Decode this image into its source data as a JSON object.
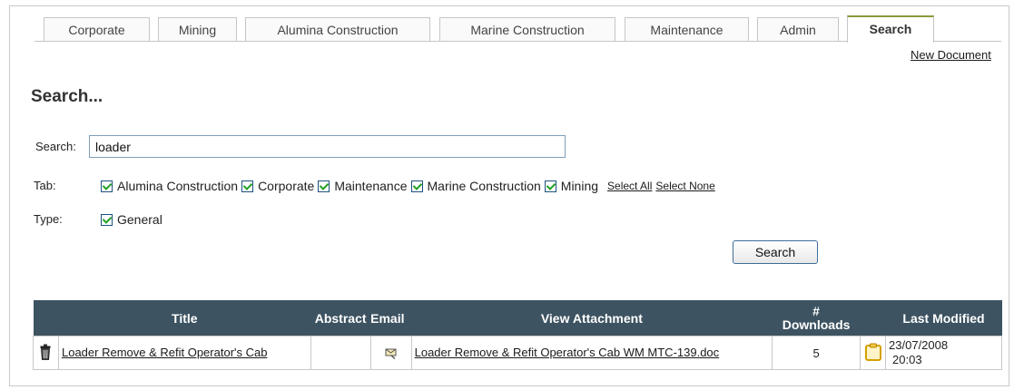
{
  "tabs": [
    {
      "label": "Corporate",
      "active": false
    },
    {
      "label": "Mining",
      "active": false
    },
    {
      "label": "Alumina Construction",
      "active": false
    },
    {
      "label": "Marine Construction",
      "active": false
    },
    {
      "label": "Maintenance",
      "active": false
    },
    {
      "label": "Admin",
      "active": false
    },
    {
      "label": "Search",
      "active": true
    }
  ],
  "new_document_link": "New Document",
  "page_title": "Search...",
  "form": {
    "search_label": "Search:",
    "search_value": "loader",
    "tab_label": "Tab:",
    "tab_options": [
      {
        "label": "Alumina Construction",
        "checked": true
      },
      {
        "label": "Corporate",
        "checked": true
      },
      {
        "label": "Maintenance",
        "checked": true
      },
      {
        "label": "Marine Construction",
        "checked": true
      },
      {
        "label": "Mining",
        "checked": true
      }
    ],
    "select_all": "Select All",
    "select_none": "Select None",
    "type_label": "Type:",
    "type_options": [
      {
        "label": "General",
        "checked": true
      }
    ],
    "search_button": "Search"
  },
  "results": {
    "headers": {
      "title": "Title",
      "abstract": "Abstract",
      "email": "Email",
      "view_attachment": "View Attachment",
      "downloads_top": "#",
      "downloads_bottom": "Downloads",
      "last_modified": "Last Modified"
    },
    "rows": [
      {
        "title": "Loader Remove & Refit Operator's Cab",
        "abstract": "",
        "attachment": "Loader Remove & Refit Operator's Cab WM MTC-139.doc",
        "downloads": "5",
        "date": "23/07/2008",
        "time": "20:03"
      }
    ]
  },
  "colors": {
    "header_bg": "#3d5361",
    "active_tab_border": "#8a9a3a",
    "checkbox_check": "#21a121"
  },
  "icons": {
    "delete": "trash-icon",
    "email": "email-icon",
    "clipboard": "clipboard-icon"
  }
}
